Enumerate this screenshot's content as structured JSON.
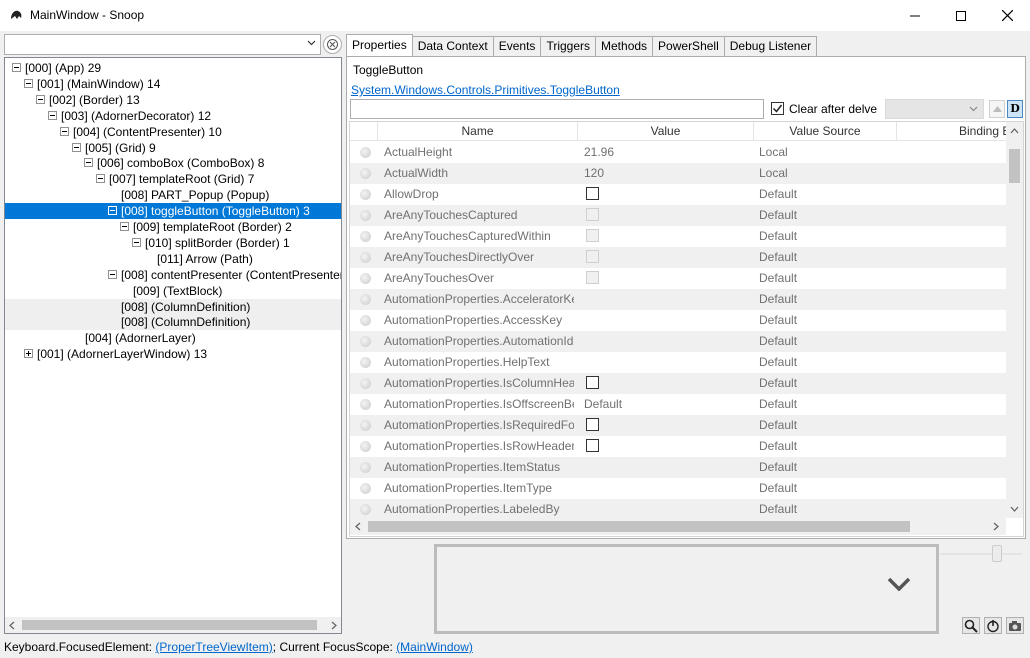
{
  "window": {
    "title": "MainWindow - Snoop"
  },
  "tree": {
    "rows": [
      {
        "label": "[000]  (App) 29",
        "expander": "minus"
      },
      {
        "label": "[001]  (MainWindow) 14",
        "expander": "minus"
      },
      {
        "label": "[002]  (Border) 13",
        "expander": "minus"
      },
      {
        "label": "[003]  (AdornerDecorator) 12",
        "expander": "minus"
      },
      {
        "label": "[004]  (ContentPresenter) 10",
        "expander": "minus"
      },
      {
        "label": "[005]  (Grid) 9",
        "expander": "minus"
      },
      {
        "label": "[006] comboBox (ComboBox) 8",
        "expander": "minus"
      },
      {
        "label": "[007] templateRoot (Grid) 7",
        "expander": "minus"
      },
      {
        "label": "[008] PART_Popup (Popup)",
        "expander": "none"
      },
      {
        "label": "[008] toggleButton (ToggleButton) 3",
        "expander": "minus",
        "selected": true
      },
      {
        "label": "[009] templateRoot (Border) 2",
        "expander": "minus"
      },
      {
        "label": "[010] splitBorder (Border) 1",
        "expander": "minus"
      },
      {
        "label": "[011] Arrow (Path)",
        "expander": "none"
      },
      {
        "label": "[008] contentPresenter (ContentPresenter",
        "expander": "minus"
      },
      {
        "label": "[009]  (TextBlock)",
        "expander": "none"
      },
      {
        "label": "[008]  (ColumnDefinition)",
        "expander": "none"
      },
      {
        "label": "[008]  (ColumnDefinition)",
        "expander": "none"
      },
      {
        "label": "[004]  (AdornerLayer)",
        "expander": "none"
      },
      {
        "label": "[001]  (AdornerLayerWindow) 13",
        "expander": "plus"
      }
    ]
  },
  "tabs": [
    "Properties",
    "Data Context",
    "Events",
    "Triggers",
    "Methods",
    "PowerShell",
    "Debug Listener"
  ],
  "properties_panel": {
    "element_name": "ToggleButton",
    "element_type": "System.Windows.Controls.Primitives.ToggleButton",
    "filter_value": "",
    "clear_after_delve_label": "Clear after delve",
    "clear_after_delve_checked": true,
    "d_button_label": "D",
    "columns": [
      "Name",
      "Value",
      "Value Source",
      "Binding E"
    ],
    "rows": [
      {
        "name": "ActualHeight",
        "value": "21.96",
        "source": "Local"
      },
      {
        "name": "ActualWidth",
        "value": "120",
        "source": "Local"
      },
      {
        "name": "AllowDrop",
        "value": "",
        "source": "Default",
        "checkbox": "enabled"
      },
      {
        "name": "AreAnyTouchesCaptured",
        "value": "",
        "source": "Default",
        "checkbox": "disabled"
      },
      {
        "name": "AreAnyTouchesCapturedWithin",
        "value": "",
        "source": "Default",
        "checkbox": "disabled"
      },
      {
        "name": "AreAnyTouchesDirectlyOver",
        "value": "",
        "source": "Default",
        "checkbox": "disabled"
      },
      {
        "name": "AreAnyTouchesOver",
        "value": "",
        "source": "Default",
        "checkbox": "disabled"
      },
      {
        "name": "AutomationProperties.AcceleratorKey",
        "value": "",
        "source": "Default"
      },
      {
        "name": "AutomationProperties.AccessKey",
        "value": "",
        "source": "Default"
      },
      {
        "name": "AutomationProperties.AutomationId",
        "value": "",
        "source": "Default"
      },
      {
        "name": "AutomationProperties.HelpText",
        "value": "",
        "source": "Default"
      },
      {
        "name": "AutomationProperties.IsColumnHeader",
        "value": "",
        "source": "Default",
        "checkbox": "enabled"
      },
      {
        "name": "AutomationProperties.IsOffscreenBehavior",
        "value": "Default",
        "source": "Default"
      },
      {
        "name": "AutomationProperties.IsRequiredForForm",
        "value": "",
        "source": "Default",
        "checkbox": "enabled"
      },
      {
        "name": "AutomationProperties.IsRowHeader",
        "value": "",
        "source": "Default",
        "checkbox": "enabled"
      },
      {
        "name": "AutomationProperties.ItemStatus",
        "value": "",
        "source": "Default"
      },
      {
        "name": "AutomationProperties.ItemType",
        "value": "",
        "source": "Default"
      },
      {
        "name": "AutomationProperties.LabeledBy",
        "value": "",
        "source": "Default"
      }
    ]
  },
  "status": {
    "prefix": "Keyboard.FocusedElement: ",
    "focused_element": "(ProperTreeViewItem)",
    "middle": "; Current FocusScope: ",
    "focus_scope": "(MainWindow)"
  },
  "colors": {
    "selection": "#0078d7",
    "link": "#0066cc"
  }
}
